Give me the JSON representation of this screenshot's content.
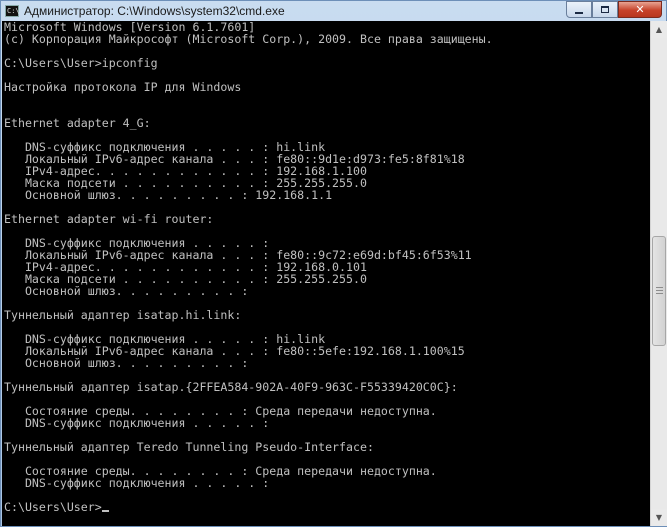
{
  "window": {
    "title": "Администратор: C:\\Windows\\system32\\cmd.exe",
    "icon": "cmd-icon"
  },
  "console": {
    "lines": [
      "Microsoft Windows [Version 6.1.7601]",
      "(с) Корпорация Майкрософт (Microsoft Corp.), 2009. Все права защищены.",
      "",
      "C:\\Users\\User>ipconfig",
      "",
      "Настройка протокола IP для Windows",
      "",
      "",
      "Ethernet adapter 4_G:",
      "",
      "   DNS-суффикс подключения . . . . . : hi.link",
      "   Локальный IPv6-адрес канала . . . : fe80::9d1e:d973:fe5:8f81%18",
      "   IPv4-адрес. . . . . . . . . . . . : 192.168.1.100",
      "   Маска подсети . . . . . . . . . . : 255.255.255.0",
      "   Основной шлюз. . . . . . . . . : 192.168.1.1",
      "",
      "Ethernet adapter wi-fi router:",
      "",
      "   DNS-суффикс подключения . . . . . :",
      "   Локальный IPv6-адрес канала . . . : fe80::9c72:e69d:bf45:6f53%11",
      "   IPv4-адрес. . . . . . . . . . . . : 192.168.0.101",
      "   Маска подсети . . . . . . . . . . : 255.255.255.0",
      "   Основной шлюз. . . . . . . . . :",
      "",
      "Туннельный адаптер isatap.hi.link:",
      "",
      "   DNS-суффикс подключения . . . . . : hi.link",
      "   Локальный IPv6-адрес канала . . . : fe80::5efe:192.168.1.100%15",
      "   Основной шлюз. . . . . . . . . :",
      "",
      "Туннельный адаптер isatap.{2FFEA584-902A-40F9-963C-F55339420C0C}:",
      "",
      "   Состояние среды. . . . . . . . : Среда передачи недоступна.",
      "   DNS-суффикс подключения . . . . . :",
      "",
      "Туннельный адаптер Teredo Tunneling Pseudo-Interface:",
      "",
      "   Состояние среды. . . . . . . . : Среда передачи недоступна.",
      "   DNS-суффикс подключения . . . . . :",
      "",
      "C:\\Users\\User>"
    ]
  },
  "controls": {
    "minimize_icon": "minimize-icon",
    "maximize_icon": "maximize-icon",
    "close_label": "✕"
  },
  "scrollbar": {
    "up_arrow": "▲",
    "down_arrow": "▼"
  },
  "colors": {
    "console_bg": "#000000",
    "console_fg": "#c0c0c0",
    "close_red": "#c7432b"
  }
}
